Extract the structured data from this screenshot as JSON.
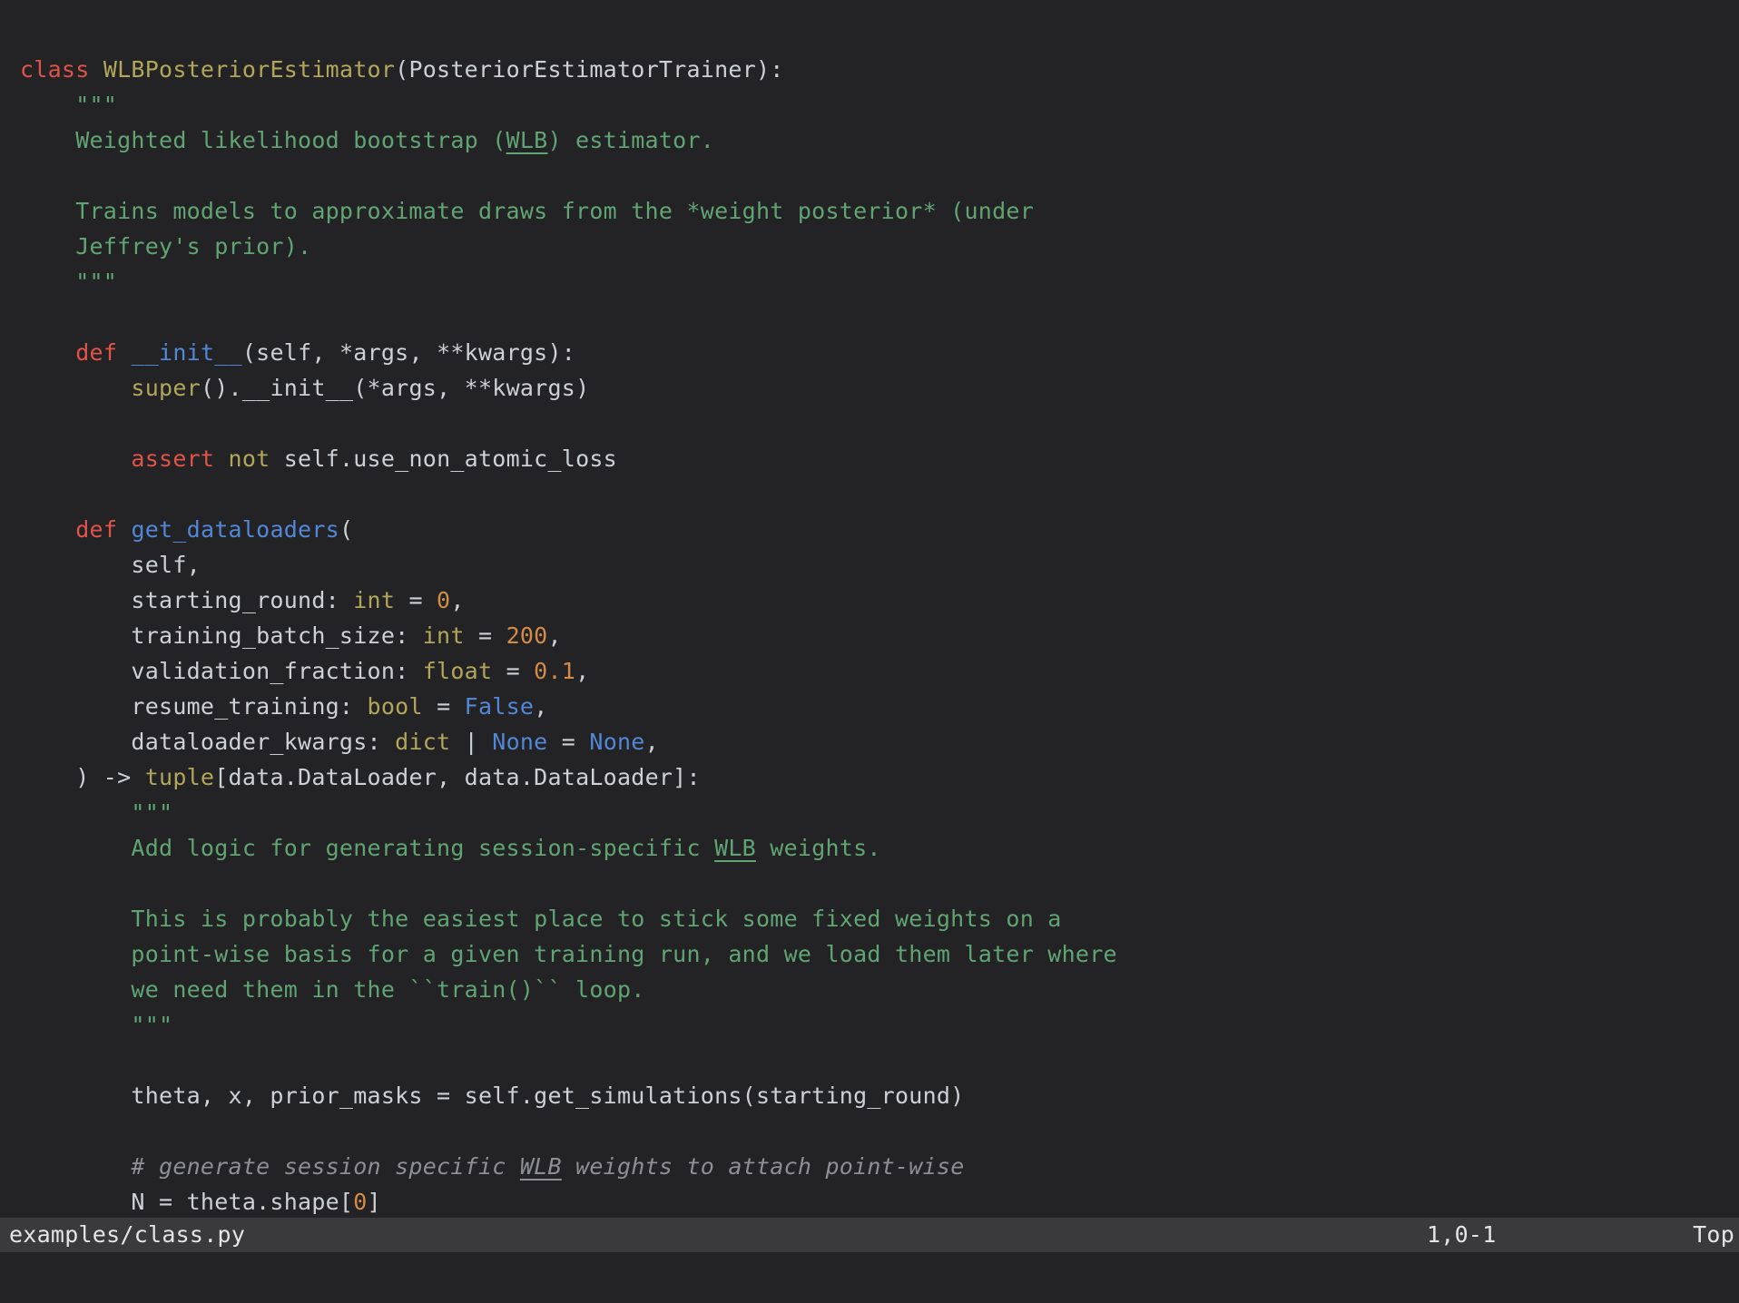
{
  "editor": {
    "colors": {
      "background": "#232325",
      "foreground": "#cdd0d4",
      "keyword": "#df5348",
      "type": "#b1a65a",
      "function": "#5287d8",
      "constant": "#5287d8",
      "number": "#d28c47",
      "string": "#61a473",
      "comment": "#8e8f92",
      "statusbar_background": "#3a3a3c",
      "statusbar_foreground": "#e5e5e7"
    },
    "lines": [
      [],
      [
        {
          "t": "class",
          "c": "k"
        },
        {
          "t": " ",
          "c": "d"
        },
        {
          "t": "WLBPosteriorEstimator",
          "c": "t"
        },
        {
          "t": "(PosteriorEstimatorTrainer):",
          "c": "d"
        }
      ],
      [
        {
          "t": "    \"\"\"",
          "c": "s"
        }
      ],
      [
        {
          "t": "    Weighted likelihood bootstrap (",
          "c": "s"
        },
        {
          "t": "WLB",
          "c": "su"
        },
        {
          "t": ") estimator.",
          "c": "s"
        }
      ],
      [],
      [
        {
          "t": "    Trains models to approximate draws from the *weight posterior* (under",
          "c": "s"
        }
      ],
      [
        {
          "t": "    Jeffrey's prior).",
          "c": "s"
        }
      ],
      [
        {
          "t": "    \"\"\"",
          "c": "s"
        }
      ],
      [],
      [
        {
          "t": "    ",
          "c": "d"
        },
        {
          "t": "def",
          "c": "k"
        },
        {
          "t": " ",
          "c": "d"
        },
        {
          "t": "__init__",
          "c": "f"
        },
        {
          "t": "(self, *args, **kwargs):",
          "c": "d"
        }
      ],
      [
        {
          "t": "        ",
          "c": "d"
        },
        {
          "t": "super",
          "c": "t"
        },
        {
          "t": "().__init__(*args, **kwargs)",
          "c": "d"
        }
      ],
      [],
      [
        {
          "t": "        ",
          "c": "d"
        },
        {
          "t": "assert",
          "c": "k"
        },
        {
          "t": " ",
          "c": "d"
        },
        {
          "t": "not",
          "c": "t"
        },
        {
          "t": " self.use_non_atomic_loss",
          "c": "d"
        }
      ],
      [],
      [
        {
          "t": "    ",
          "c": "d"
        },
        {
          "t": "def",
          "c": "k"
        },
        {
          "t": " ",
          "c": "d"
        },
        {
          "t": "get_dataloaders",
          "c": "f"
        },
        {
          "t": "(",
          "c": "d"
        }
      ],
      [
        {
          "t": "        self,",
          "c": "d"
        }
      ],
      [
        {
          "t": "        starting_round: ",
          "c": "d"
        },
        {
          "t": "int",
          "c": "t"
        },
        {
          "t": " = ",
          "c": "d"
        },
        {
          "t": "0",
          "c": "n"
        },
        {
          "t": ",",
          "c": "d"
        }
      ],
      [
        {
          "t": "        training_batch_size: ",
          "c": "d"
        },
        {
          "t": "int",
          "c": "t"
        },
        {
          "t": " = ",
          "c": "d"
        },
        {
          "t": "200",
          "c": "n"
        },
        {
          "t": ",",
          "c": "d"
        }
      ],
      [
        {
          "t": "        validation_fraction: ",
          "c": "d"
        },
        {
          "t": "float",
          "c": "t"
        },
        {
          "t": " = ",
          "c": "d"
        },
        {
          "t": "0.1",
          "c": "n"
        },
        {
          "t": ",",
          "c": "d"
        }
      ],
      [
        {
          "t": "        resume_training: ",
          "c": "d"
        },
        {
          "t": "bool",
          "c": "t"
        },
        {
          "t": " = ",
          "c": "d"
        },
        {
          "t": "False",
          "c": "b"
        },
        {
          "t": ",",
          "c": "d"
        }
      ],
      [
        {
          "t": "        dataloader_kwargs: ",
          "c": "d"
        },
        {
          "t": "dict",
          "c": "t"
        },
        {
          "t": " | ",
          "c": "d"
        },
        {
          "t": "None",
          "c": "b"
        },
        {
          "t": " = ",
          "c": "d"
        },
        {
          "t": "None",
          "c": "b"
        },
        {
          "t": ",",
          "c": "d"
        }
      ],
      [
        {
          "t": "    ) -> ",
          "c": "d"
        },
        {
          "t": "tuple",
          "c": "t"
        },
        {
          "t": "[data.DataLoader, data.DataLoader]:",
          "c": "d"
        }
      ],
      [
        {
          "t": "        \"\"\"",
          "c": "s"
        }
      ],
      [
        {
          "t": "        Add logic for generating session-specific ",
          "c": "s"
        },
        {
          "t": "WLB",
          "c": "su"
        },
        {
          "t": " weights.",
          "c": "s"
        }
      ],
      [],
      [
        {
          "t": "        This is probably the easiest place to stick some fixed weights on a",
          "c": "s"
        }
      ],
      [
        {
          "t": "        point-wise basis for a given training run, and we load them later where",
          "c": "s"
        }
      ],
      [
        {
          "t": "        we need them in the ``train()`` loop.",
          "c": "s"
        }
      ],
      [
        {
          "t": "        \"\"\"",
          "c": "s"
        }
      ],
      [],
      [
        {
          "t": "        theta, x, prior_masks = self.get_simulations(starting_round)",
          "c": "d"
        }
      ],
      [],
      [
        {
          "t": "        # generate session specific ",
          "c": "c"
        },
        {
          "t": "WLB",
          "c": "cu"
        },
        {
          "t": " weights to attach point-wise",
          "c": "c"
        }
      ],
      [
        {
          "t": "        N = theta.shape[",
          "c": "d"
        },
        {
          "t": "0",
          "c": "n"
        },
        {
          "t": "]",
          "c": "d"
        }
      ]
    ]
  },
  "status_bar": {
    "filename": "examples/class.py",
    "ruler": "1,0-1",
    "scroll_position": "Top"
  }
}
